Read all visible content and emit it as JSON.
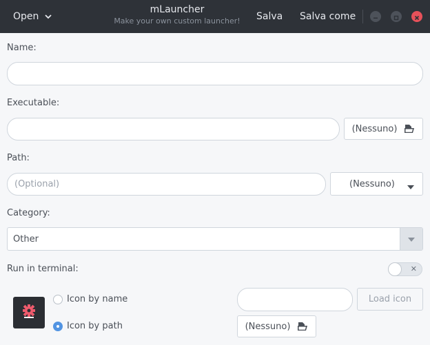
{
  "header": {
    "open_label": "Open",
    "title": "mLauncher",
    "subtitle": "Make your own custom launcher!",
    "save_label": "Salva",
    "save_as_label": "Salva come"
  },
  "form": {
    "name": {
      "label": "Name:",
      "value": "",
      "placeholder": ""
    },
    "executable": {
      "label": "Executable:",
      "value": "",
      "button_label": "(Nessuno)"
    },
    "path": {
      "label": "Path:",
      "value": "",
      "placeholder": "(Optional)",
      "combo_value": "(Nessuno)"
    },
    "category": {
      "label": "Category:",
      "value": "Other"
    },
    "run_in_terminal": {
      "label": "Run in terminal:",
      "enabled": false
    },
    "icon": {
      "by_name_label": "Icon by name",
      "by_path_label": "Icon by path",
      "selected": "path",
      "name_value": "",
      "load_label": "Load icon",
      "path_button_label": "(Nessuno)"
    }
  },
  "colors": {
    "header_bg": "#2e3238",
    "accent": "#5294e2",
    "close": "#e6515a",
    "icon_accent": "#ef5b6d"
  }
}
